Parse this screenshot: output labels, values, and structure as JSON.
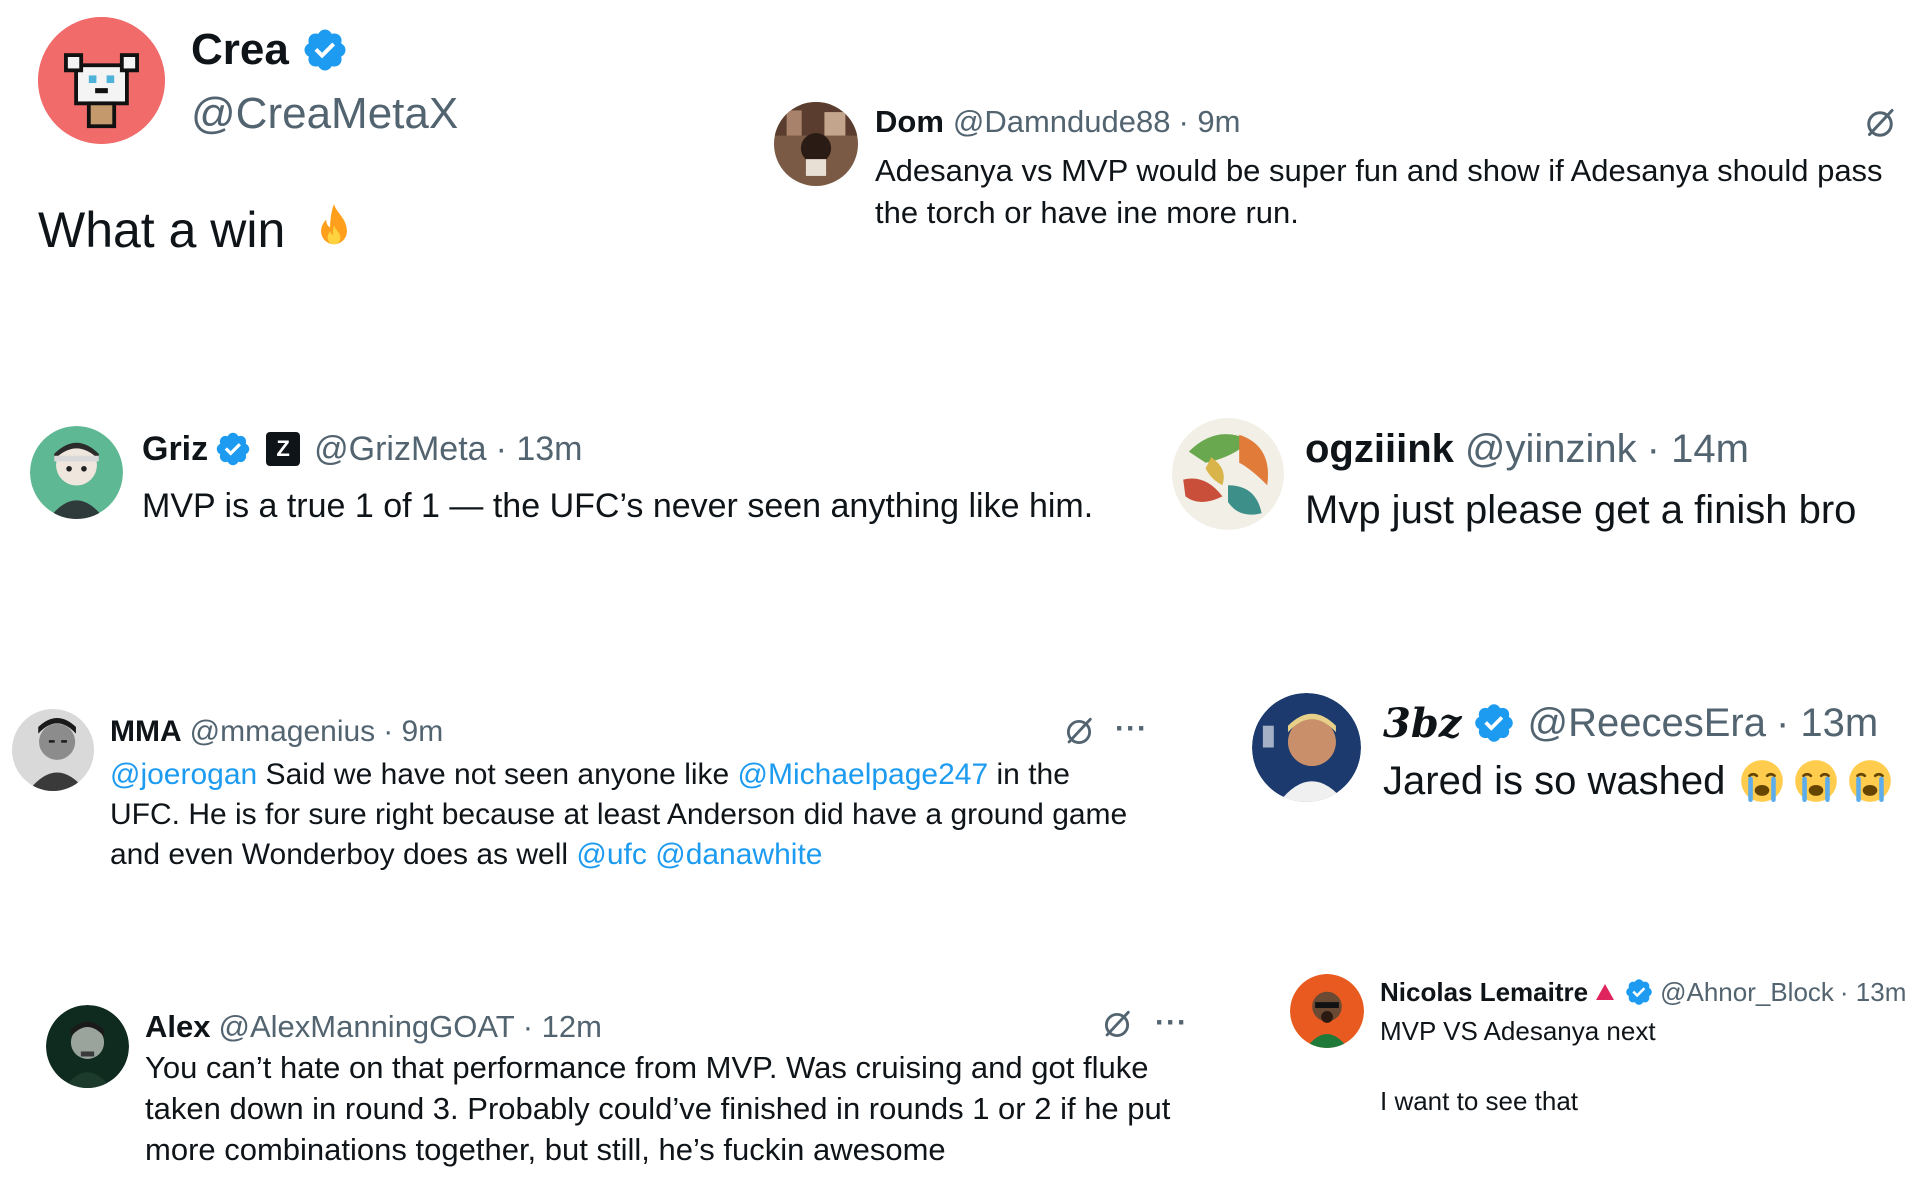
{
  "accent_color": "#1d9bf0",
  "muted_color": "#536471",
  "tweets": {
    "crea": {
      "name": "Crea",
      "handle": "@CreaMetaX",
      "text": "What a win",
      "emoji": "fire-emoji",
      "verified": true
    },
    "dom": {
      "name": "Dom",
      "handle": "@Damndude88",
      "time": "· 9m",
      "text_line1": "Adesanya vs MVP would be super fun and show if Adesanya should pass",
      "text_line2": "the torch or have ine more run."
    },
    "griz": {
      "name": "Griz",
      "affiliate_badge": "Z",
      "handle": "@GrizMeta",
      "time": "· 13m",
      "text": "MVP is a true 1 of 1 — the UFC’s never seen anything like him.",
      "verified": true
    },
    "ogziiink": {
      "name": "ogziiink",
      "handle": "@yiinzink",
      "time": "· 14m",
      "text": "Mvp just please get a finish bro"
    },
    "mma": {
      "name": "MMA",
      "handle": "@mmagenius",
      "time": "· 9m",
      "mention1": "@joerogan",
      "text1": " Said we have not seen anyone like ",
      "mention2": "@Michaelpage247",
      "text2": " in the",
      "text_line2": "UFC. He is for sure right because at least Anderson did have a ground game",
      "text_line3": "and even Wonderboy does as well ",
      "mention3": "@ufc",
      "mention4": "@danawhite",
      "more": "···"
    },
    "threebz": {
      "name": "3bz",
      "handle": "@ReecesEra",
      "time": "· 13m",
      "text": "Jared is so washed",
      "emoji": "loudly-crying-emoji",
      "verified": true
    },
    "alex": {
      "name": "Alex",
      "handle": "@AlexManningGOAT",
      "time": "· 12m",
      "text_line1": "You can’t hate on that performance from MVP. Was cruising and got fluke",
      "text_line2": "taken down in round 3. Probably could’ve finished in rounds 1 or 2 if he put",
      "text_line3": "more combinations together, but still, he’s fuckin awesome",
      "more": "···"
    },
    "nicolas": {
      "name": "Nicolas Lemaitre",
      "handle": "@Ahnor_Block",
      "time": "· 13m",
      "text_line1": "MVP VS Adesanya next",
      "text_line2": "I want to see that",
      "verified": true
    }
  }
}
